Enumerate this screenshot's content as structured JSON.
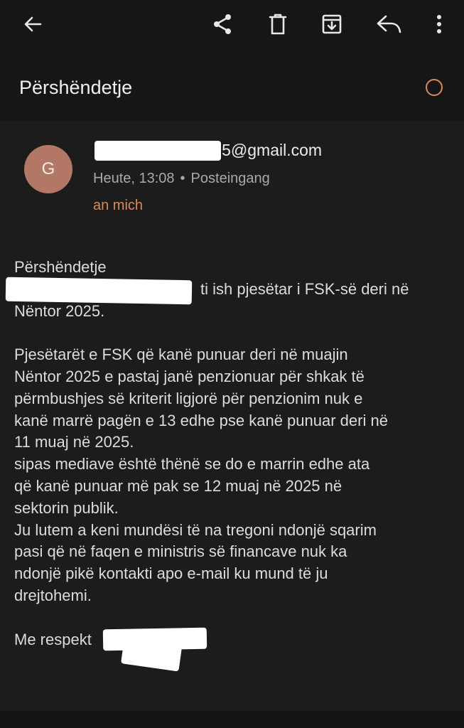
{
  "subject": "Përshëndetje",
  "sender": {
    "avatar_letter": "G",
    "email_visible": "i5@gmail.com",
    "date": "Heute, 13:08",
    "folder": "Posteingang",
    "recipient": "an mich"
  },
  "toolbar": {
    "icons": [
      "back-arrow-icon",
      "share-icon",
      "delete-icon",
      "archive-icon",
      "reply-icon",
      "more-vertical-icon"
    ]
  },
  "body": {
    "greeting": "Përshëndetje",
    "line1_visible": "ti ish pjesëtar i FSK-së deri në",
    "line2": "Nëntor 2025.",
    "para2": "Pjesëtarët e FSK që kanë punuar deri në muajin\nNëntor 2025 e pastaj janë penzionuar për shkak të\npërmbushjes së kriterit ligjorë për penzionim nuk e\nkanë marrë pagën e 13 edhe pse kanë punuar deri në\n11 muaj në 2025.\nsipas mediave është thënë se do e marrin edhe ata\nqë kanë punuar më pak se 12 muaj në 2025 në\nsektorin publik.\nJu lutem a keni mundësi të na tregoni ndonjë sqarim\npasi që në faqen e ministris së financave nuk ka\nndonjë pikë kontakti apo e-mail ku mund të ju\ndrejtohemi.",
    "closing_visible": "Me respekt"
  },
  "colors": {
    "background": "#1c1c1c",
    "topbar": "#161616",
    "accent": "#d98a57",
    "avatar": "#b27865"
  }
}
